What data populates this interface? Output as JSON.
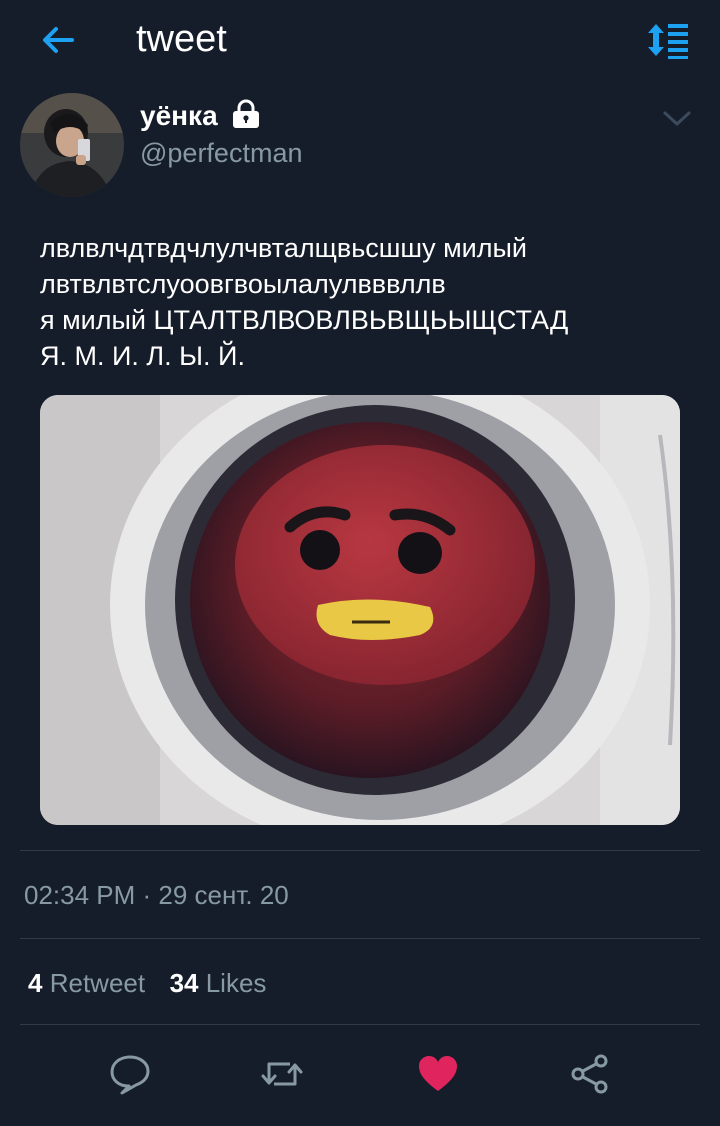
{
  "header": {
    "title": "tweet",
    "back_icon": "arrow-left-icon",
    "sort_icon": "sort-list-icon"
  },
  "author": {
    "display_name": "уёнка",
    "handle": "@perfectman",
    "lock_icon": "lock-icon"
  },
  "tweet": {
    "text": " лвлвлчдтвдчлулчвталщвьсшшу милый\nлвтвлвтслуоовгвоылалулвввллв\nя милый ЦТАЛТВЛВОВЛВЬВЩЬЫЩСТАД\nЯ. М. И. Л. Ы. Й."
  },
  "meta": {
    "timestamp": "02:34 PM · 29 сент. 20"
  },
  "stats": {
    "retweets": "4",
    "retweet_label": "Retweet",
    "likes": "34",
    "likes_label": "Likes"
  },
  "colors": {
    "background": "#161d2a",
    "accent": "#1da1f2",
    "muted": "#8899a6",
    "like": "#e0245e",
    "divider": "#2f3b4a"
  }
}
